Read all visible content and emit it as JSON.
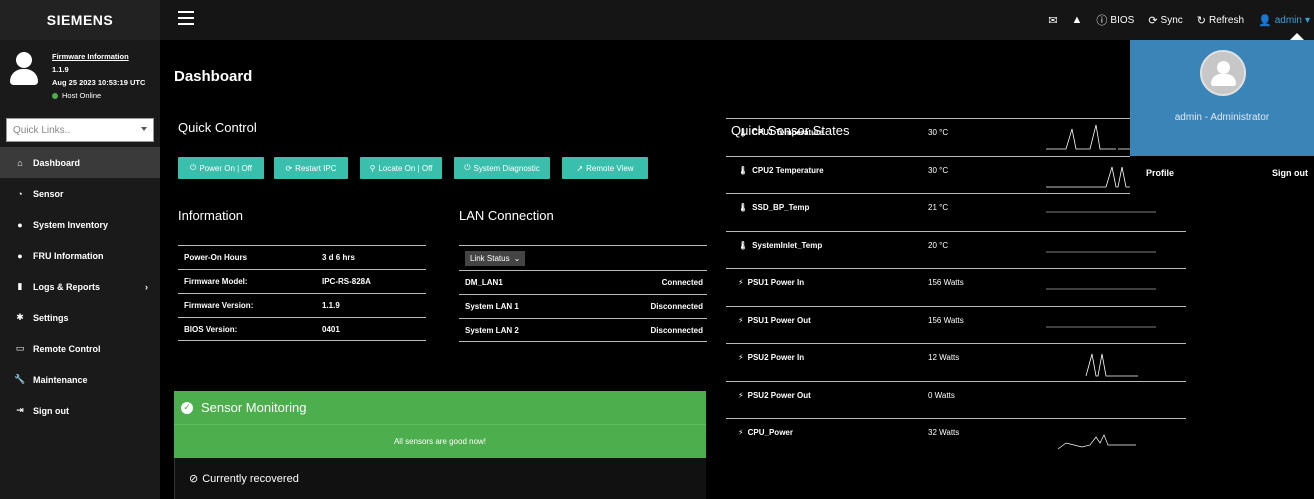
{
  "brand": "SIEMENS",
  "topbar": {
    "bios": "BIOS",
    "sync": "Sync",
    "refresh": "Refresh",
    "user": "admin"
  },
  "firmware": {
    "title": "Firmware Information",
    "version": "1.1.9",
    "date": "Aug 25 2023 10:53:19 UTC",
    "host_status": "Host Online"
  },
  "quick_links": {
    "placeholder": "Quick Links.."
  },
  "nav": [
    {
      "label": "Dashboard",
      "icon": "tachometer-icon"
    },
    {
      "label": "Sensor",
      "icon": "gauge-icon"
    },
    {
      "label": "System Inventory",
      "icon": "info-icon"
    },
    {
      "label": "FRU Information",
      "icon": "info-icon"
    },
    {
      "label": "Logs & Reports",
      "icon": "bar-chart-icon"
    },
    {
      "label": "Settings",
      "icon": "gear-icon"
    },
    {
      "label": "Remote Control",
      "icon": "monitor-icon"
    },
    {
      "label": "Maintenance",
      "icon": "wrench-icon"
    },
    {
      "label": "Sign out",
      "icon": "sign-out-icon"
    }
  ],
  "main": {
    "title": "Dashboard",
    "quick_control": {
      "title": "Quick Control",
      "buttons": [
        "Power On | Off",
        "Restart IPC",
        "Locate On | Off",
        "System Diagnostic",
        "Remote View"
      ]
    },
    "information": {
      "title": "Information",
      "rows": [
        {
          "key": "Power-On Hours",
          "value": "3 d 6 hrs"
        },
        {
          "key": "Firmware Model:",
          "value": "IPC-RS-828A"
        },
        {
          "key": "Firmware Version:",
          "value": "1.1.9"
        },
        {
          "key": "BIOS Version:",
          "value": "0401"
        }
      ]
    },
    "lan": {
      "title": "LAN Connection",
      "select": "Link Status",
      "rows": [
        {
          "name": "DM_LAN1",
          "status": "Connected"
        },
        {
          "name": "System LAN 1",
          "status": "Disconnected"
        },
        {
          "name": "System LAN 2",
          "status": "Disconnected"
        }
      ]
    },
    "sensor_monitoring": {
      "title": "Sensor Monitoring",
      "message": "All sensors are good now!",
      "recovered": "Currently recovered"
    }
  },
  "quick_sensors": {
    "title": "Quick Sensor States",
    "rows": [
      {
        "name": "CPU1 Temperature",
        "value": "30 °C",
        "icon": "thermometer-icon"
      },
      {
        "name": "CPU2 Temperature",
        "value": "30 °C",
        "icon": "thermometer-icon"
      },
      {
        "name": "SSD_BP_Temp",
        "value": "21 °C",
        "icon": "thermometer-icon"
      },
      {
        "name": "SystemInlet_Temp",
        "value": "20 °C",
        "icon": "thermometer-icon"
      },
      {
        "name": "PSU1 Power In",
        "value": "156 Watts",
        "icon": "power-icon"
      },
      {
        "name": "PSU1 Power Out",
        "value": "156 Watts",
        "icon": "power-icon"
      },
      {
        "name": "PSU2 Power In",
        "value": "12 Watts",
        "icon": "power-icon"
      },
      {
        "name": "PSU2 Power Out",
        "value": "0 Watts",
        "icon": "power-icon"
      },
      {
        "name": "CPU_Power",
        "value": "32 Watts",
        "icon": "power-icon"
      }
    ]
  },
  "admin_menu": {
    "name": "admin - Administrator",
    "profile": "Profile",
    "signout": "Sign out"
  },
  "colors": {
    "accent_teal": "#3bbfad",
    "success_green": "#4cae4c",
    "admin_blue": "#3a84b8"
  }
}
